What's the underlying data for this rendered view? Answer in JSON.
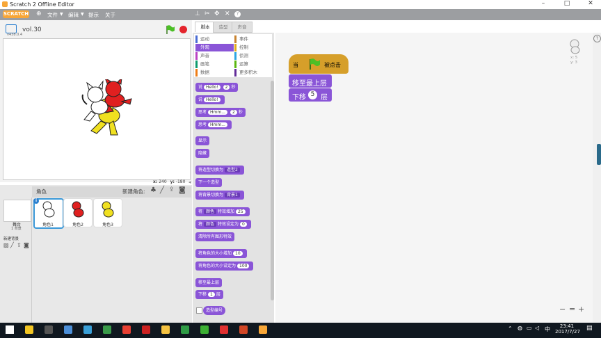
{
  "window": {
    "title": "Scratch 2 Offline Editor",
    "minimize": "–",
    "maximize": "□",
    "close": "✕"
  },
  "menu": {
    "logo": "SCRATCH",
    "items": [
      "文件",
      "编辑",
      "提示",
      "关于"
    ],
    "globe_icon": "globe-icon",
    "toolbar_icons": [
      "stamp-icon",
      "cut-icon",
      "grow-icon",
      "shrink-icon",
      "help-icon"
    ]
  },
  "stage": {
    "project_name": "vol.30",
    "version": "v438.0.4",
    "x_label": "x:",
    "x_value": "240",
    "y_label": "y:",
    "y_value": "-180"
  },
  "sprites": {
    "header": "角色",
    "new_sprite": "新建角色:",
    "stage_label": "舞台",
    "stage_sub": "1 背景",
    "new_backdrop": "新建背景",
    "items": [
      {
        "name": "角色1",
        "color": "#ffffff"
      },
      {
        "name": "角色2",
        "color": "#e02020"
      },
      {
        "name": "角色3",
        "color": "#f0e020"
      }
    ]
  },
  "tabs": {
    "scripts": "脚本",
    "costumes": "造型",
    "sounds": "声音"
  },
  "categories": [
    {
      "label": "运动",
      "color": "#4a6cd4"
    },
    {
      "label": "事件",
      "color": "#c88330"
    },
    {
      "label": "外观",
      "color": "#8a55d7",
      "active": true
    },
    {
      "label": "控制",
      "color": "#e1a91a"
    },
    {
      "label": "声音",
      "color": "#bb42c3"
    },
    {
      "label": "侦测",
      "color": "#2ca5e2"
    },
    {
      "label": "画笔",
      "color": "#0e9a6c"
    },
    {
      "label": "运算",
      "color": "#5cb712"
    },
    {
      "label": "数据",
      "color": "#ee7d16"
    },
    {
      "label": "更多积木",
      "color": "#632d99"
    }
  ],
  "palette": {
    "say_for": [
      "说",
      "Hello!",
      "2",
      "秒"
    ],
    "say": [
      "说",
      "Hello!"
    ],
    "think_for": [
      "思考",
      "Hmm...",
      "2",
      "秒"
    ],
    "think": [
      "思考",
      "Hmm..."
    ],
    "show": "显示",
    "hide": "隐藏",
    "switch_costume": [
      "将造型切换为",
      "造型2"
    ],
    "next_costume": "下一个造型",
    "switch_backdrop": [
      "将背景切换为",
      "背景1"
    ],
    "change_effect": [
      "将",
      "颜色",
      "特效增加",
      "25"
    ],
    "set_effect": [
      "将",
      "颜色",
      "特效设定为",
      "0"
    ],
    "clear_effects": "清除所有图形特效",
    "change_size": [
      "将角色的大小增加",
      "10"
    ],
    "set_size": [
      "将角色的大小设定为",
      "100"
    ],
    "front": "移至最上层",
    "back": [
      "下移",
      "1",
      "层"
    ],
    "costume_num": "造型编号"
  },
  "script": {
    "hat": [
      "当",
      "被点击"
    ],
    "front": "移至最上层",
    "back": [
      "下移",
      "5",
      "层"
    ],
    "corner_x": "x: 5",
    "corner_y": "y: 3"
  },
  "zoom": {
    "out": "−",
    "reset": "=",
    "in": "+"
  },
  "taskbar": {
    "time": "23:41",
    "date": "2017/7/27",
    "ime": "中",
    "icons": [
      {
        "name": "start-icon",
        "color": "#ffffff"
      },
      {
        "name": "notes-icon",
        "color": "#f3c623"
      },
      {
        "name": "calculator-icon",
        "color": "#555555"
      },
      {
        "name": "app-icon",
        "color": "#4c8fd8"
      },
      {
        "name": "shield-icon",
        "color": "#3aa0d8"
      },
      {
        "name": "image-icon",
        "color": "#3a9b4a"
      },
      {
        "name": "chrome-icon",
        "color": "#e84033"
      },
      {
        "name": "record-icon",
        "color": "#cc2222"
      },
      {
        "name": "folder-icon",
        "color": "#f5c342"
      },
      {
        "name": "camtasia-icon",
        "color": "#2e9b45"
      },
      {
        "name": "wechat-icon",
        "color": "#3cb034"
      },
      {
        "name": "scratch-red-icon",
        "color": "#e03030"
      },
      {
        "name": "powerpoint-icon",
        "color": "#d24726"
      },
      {
        "name": "scratch-icon",
        "color": "#f7a637"
      }
    ]
  }
}
